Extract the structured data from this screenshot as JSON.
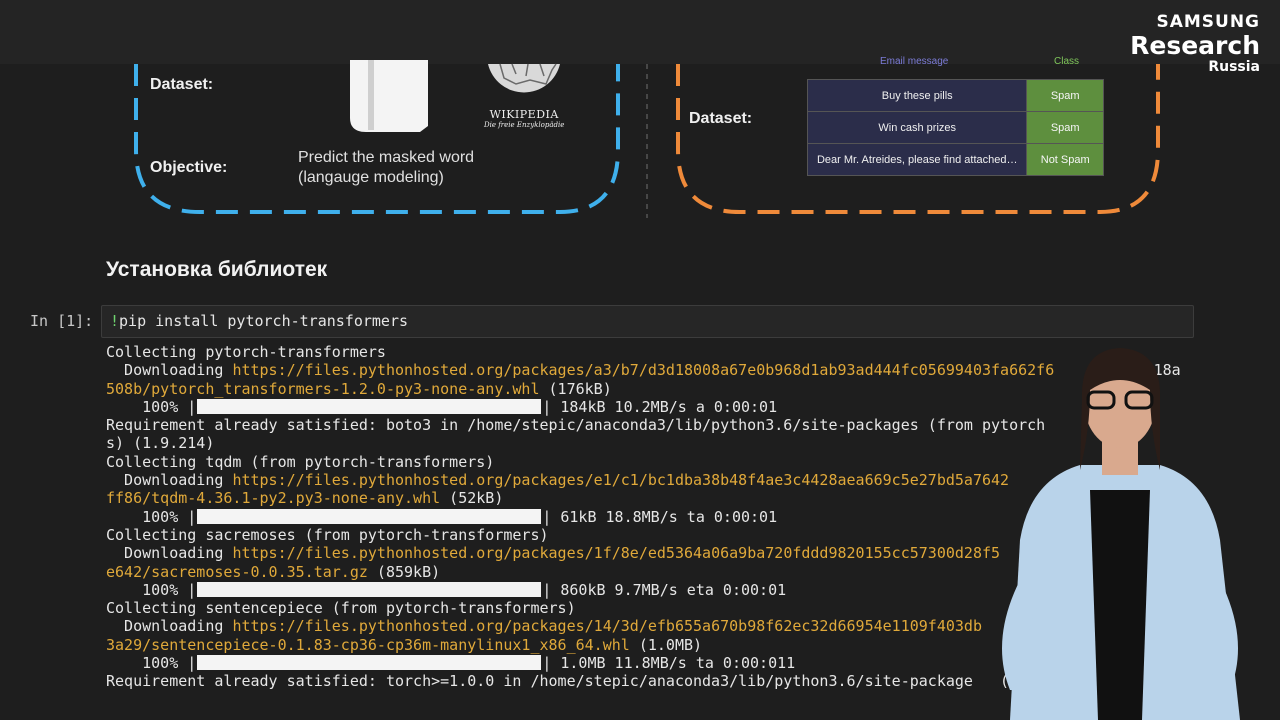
{
  "logo": {
    "line1": "SAMSUNG",
    "line2": "Research",
    "line3": "Russia"
  },
  "diagram": {
    "left": {
      "dataset_label": "Dataset:",
      "objective_label": "Objective:",
      "objective_text": [
        "Predict the masked word",
        "(langauge modeling)"
      ],
      "wiki_name": "WIKIPEDIA",
      "wiki_tagline": "Die freie Enzyklopädie"
    },
    "right": {
      "dataset_label": "Dataset:",
      "header_message": "Email message",
      "header_class": "Class",
      "rows": [
        {
          "message": "Buy these pills",
          "class": "Spam"
        },
        {
          "message": "Win cash prizes",
          "class": "Spam"
        },
        {
          "message": "Dear Mr. Atreides, please find attached…",
          "class": "Not Spam"
        }
      ]
    }
  },
  "heading": "Установка библиотек",
  "cell": {
    "prompt": "In [1]:",
    "bang": "!",
    "code": "pip install pytorch-transformers"
  },
  "output": [
    {
      "pre": "Collecting pytorch-transformers"
    },
    {
      "pre": "  Downloading ",
      "url": "https://files.pythonhosted.org/packages/a3/b7/d3d18008a67e0b968d1ab93ad444fc05699403fa662f6",
      "post": "           18a"
    },
    {
      "url": "508b/pytorch_transformers-1.2.0-py3-none-any.whl",
      "post": " (176kB)"
    },
    {
      "pre": "    100% |",
      "bar": true,
      "post": "| 184kB 10.2MB/s a 0:00:01"
    },
    {
      "pre": "Requirement already satisfied: boto3 in /home/stepic/anaconda3/lib/python3.6/site-packages (from pytorch          er"
    },
    {
      "pre": "s) (1.9.214)"
    },
    {
      "pre": "Collecting tqdm (from pytorch-transformers)"
    },
    {
      "pre": "  Downloading ",
      "url": "https://files.pythonhosted.org/packages/e1/c1/bc1dba38b48f4ae3c4428aea669c5e27bd5a7642"
    },
    {
      "url": "ff86/tqdm-4.36.1-py2.py3-none-any.whl",
      "post": " (52kB)"
    },
    {
      "pre": "    100% |",
      "bar": true,
      "post": "| 61kB 18.8MB/s ta 0:00:01"
    },
    {
      "pre": "Collecting sacremoses (from pytorch-transformers)"
    },
    {
      "pre": "  Downloading ",
      "url": "https://files.pythonhosted.org/packages/1f/8e/ed5364a06a9ba720fddd9820155cc57300d28f5"
    },
    {
      "url": "e642/sacremoses-0.0.35.tar.gz",
      "post": " (859kB)"
    },
    {
      "pre": "    100% |",
      "bar": true,
      "post": "| 860kB 9.7MB/s eta 0:00:01"
    },
    {
      "pre": "Collecting sentencepiece (from pytorch-transformers)"
    },
    {
      "pre": "  Downloading ",
      "url": "https://files.pythonhosted.org/packages/14/3d/efb655a670b98f62ec32d66954e1109f403db"
    },
    {
      "url": "3a29/sentencepiece-0.1.83-cp36-cp36m-manylinux1_x86_64.whl",
      "post": " (1.0MB)"
    },
    {
      "pre": "    100% |",
      "bar": true,
      "post": "| 1.0MB 11.8MB/s ta 0:00:011"
    },
    {
      "pre": "Requirement already satisfied: torch>=1.0.0 in /home/stepic/anaconda3/lib/python3.6/site-package   (f"
    }
  ]
}
